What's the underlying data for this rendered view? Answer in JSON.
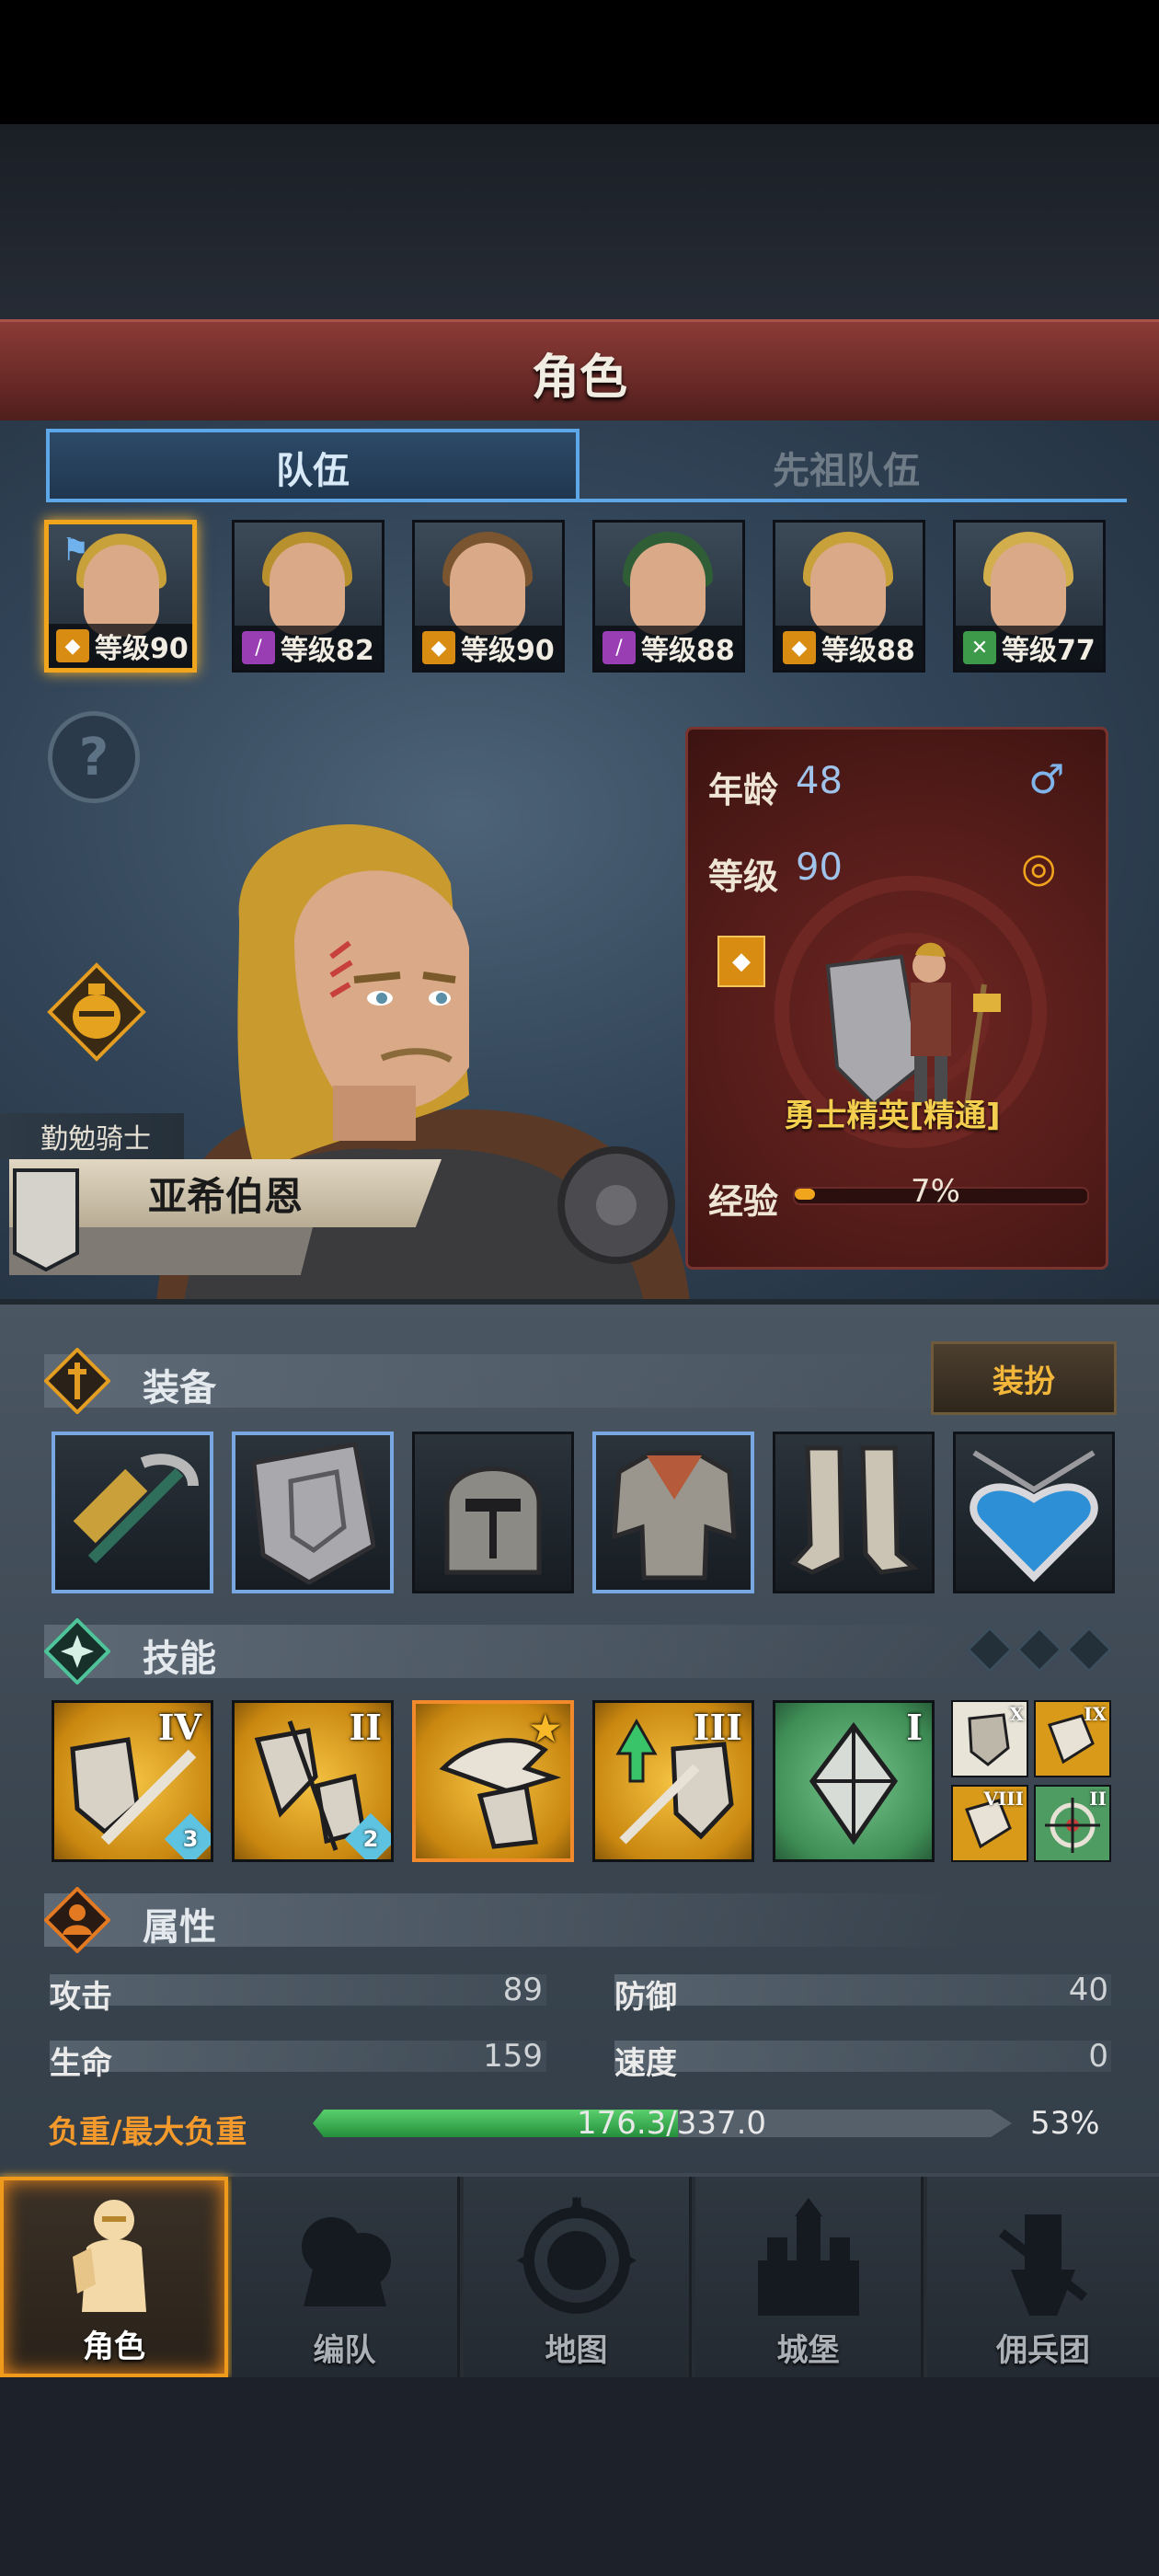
{
  "screen": {
    "title": "角色"
  },
  "tabs": [
    {
      "label": "队伍",
      "active": true
    },
    {
      "label": "先祖队伍",
      "active": false
    }
  ],
  "party": [
    {
      "level_text": "等级90",
      "class_icon": "shield-star-icon",
      "selected": true,
      "hair_color": "#c9a13a"
    },
    {
      "level_text": "等级82",
      "class_icon": "staff-icon",
      "selected": false,
      "hair_color": "#b8902e"
    },
    {
      "level_text": "等级90",
      "class_icon": "shield-star-icon",
      "selected": false,
      "hair_color": "#7a5530"
    },
    {
      "level_text": "等级88",
      "class_icon": "staff-icon",
      "selected": false,
      "hair_color": "#2f5d36"
    },
    {
      "level_text": "等级88",
      "class_icon": "shield-star-icon",
      "selected": false,
      "hair_color": "#c9a13a"
    },
    {
      "level_text": "等级77",
      "class_icon": "bow-icon",
      "selected": false,
      "hair_color": "#d2ae4d"
    }
  ],
  "character": {
    "title": "勤勉骑士",
    "name": "亚希伯恩",
    "age_label": "年龄",
    "age": "48",
    "gender_icon": "male-icon",
    "level_label": "等级",
    "level": "90",
    "ring_icon": "ring-icon",
    "class_name": "勇士精英[精通]",
    "exp_label": "经验",
    "exp_percent_text": "7%",
    "exp_fraction": 0.07
  },
  "equipment": {
    "title": "装备",
    "dress_label": "装扮",
    "items": [
      {
        "icon": "war-hammer-icon",
        "rare": true
      },
      {
        "icon": "shield-icon",
        "rare": true
      },
      {
        "icon": "helmet-icon",
        "rare": false
      },
      {
        "icon": "chainmail-armor-icon",
        "rare": true
      },
      {
        "icon": "greaves-icon",
        "rare": false
      },
      {
        "icon": "heart-amulet-icon",
        "rare": false
      }
    ]
  },
  "skills": {
    "title": "技能",
    "items": [
      {
        "icon": "shield-sword-skill-icon",
        "rank": "IV",
        "count": "3",
        "color": "gold"
      },
      {
        "icon": "shield-break-skill-icon",
        "rank": "II",
        "count": "2",
        "color": "gold"
      },
      {
        "icon": "dragon-strike-skill-icon",
        "rank": "★",
        "count": "",
        "color": "gold"
      },
      {
        "icon": "shield-up-skill-icon",
        "rank": "III",
        "count": "",
        "color": "gold"
      },
      {
        "icon": "crystal-skill-icon",
        "rank": "I",
        "count": "",
        "color": "green"
      }
    ],
    "passives": [
      {
        "icon": "shield-buff-icon",
        "rank": "X",
        "color": "gold"
      },
      {
        "icon": "armor-buff-icon",
        "rank": "IX",
        "color": "gold"
      },
      {
        "icon": "shield-buff-2-icon",
        "rank": "VIII",
        "color": "gold"
      },
      {
        "icon": "target-icon",
        "rank": "II",
        "color": "green"
      }
    ]
  },
  "attributes": {
    "title": "属性",
    "attack_label": "攻击",
    "attack": "89",
    "defense_label": "防御",
    "defense": "40",
    "health_label": "生命",
    "health": "159",
    "speed_label": "速度",
    "speed": "0",
    "load_label": "负重/最大负重",
    "load_text": "176.3/337.0",
    "load_percent_text": "53%",
    "load_fraction": 0.523
  },
  "nav": [
    {
      "label": "角色",
      "icon": "knight-icon",
      "active": true
    },
    {
      "label": "编队",
      "icon": "formation-icon",
      "active": false
    },
    {
      "label": "地图",
      "icon": "compass-map-icon",
      "active": false
    },
    {
      "label": "城堡",
      "icon": "castle-icon",
      "active": false
    },
    {
      "label": "佣兵团",
      "icon": "mercenary-icon",
      "active": false
    }
  ]
}
